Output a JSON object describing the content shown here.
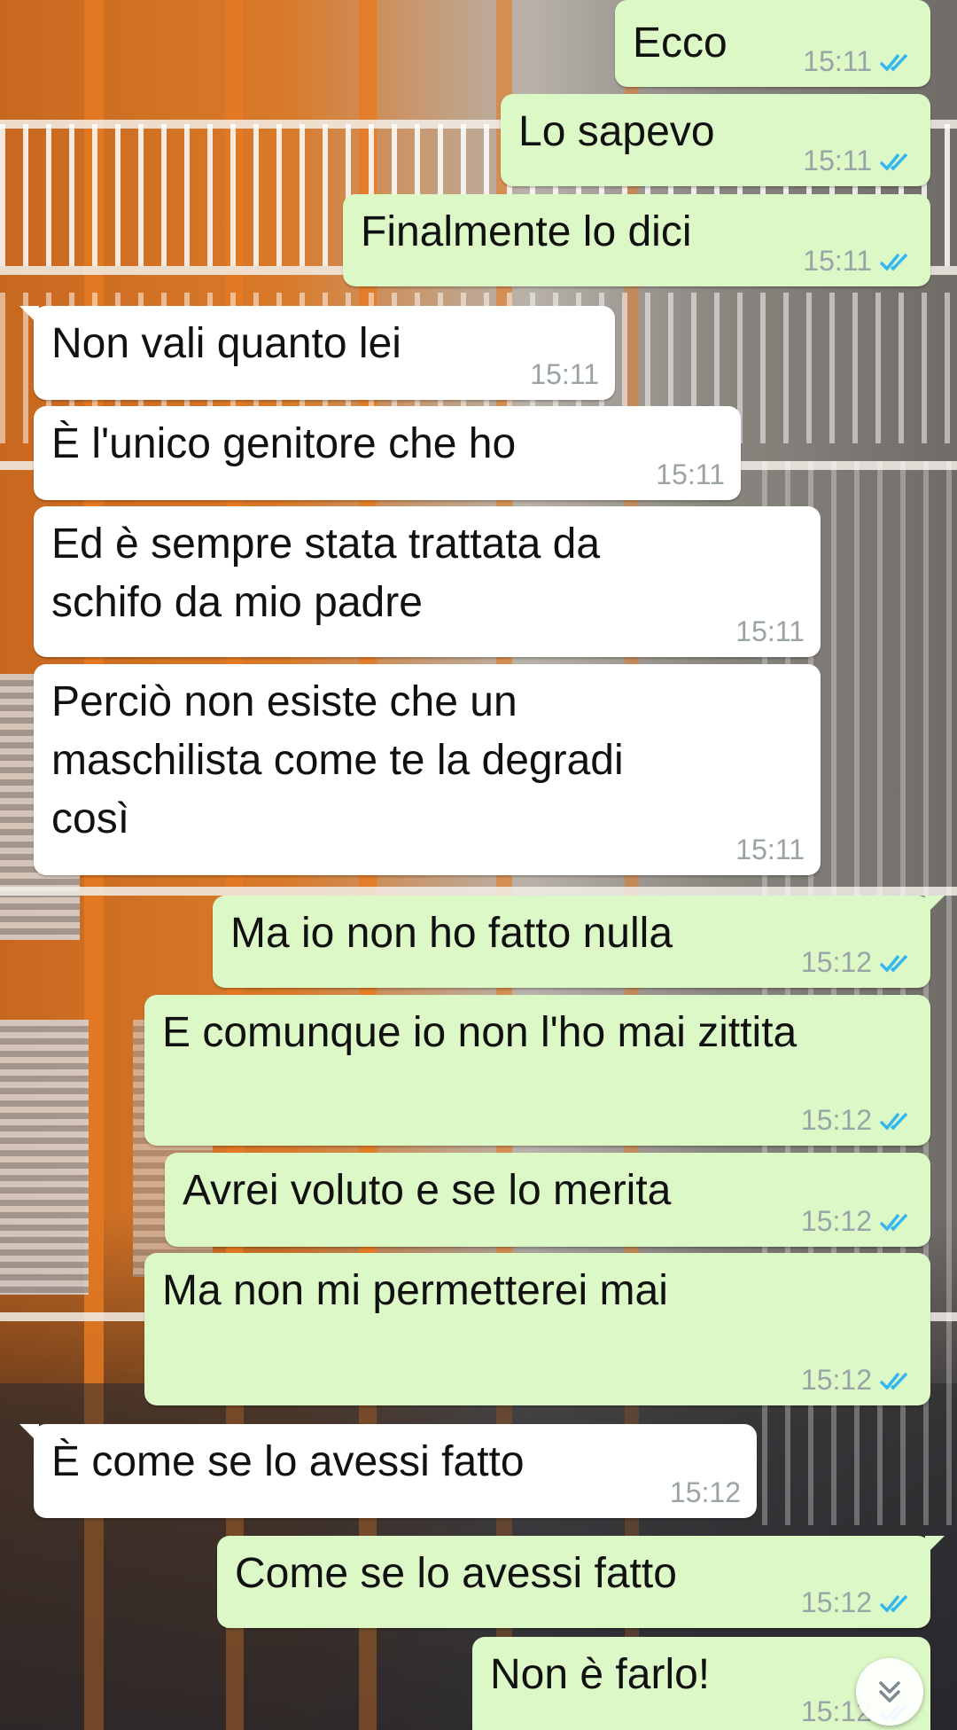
{
  "colors": {
    "outgoing_bubble": "#dcf8c6",
    "incoming_bubble": "#ffffff",
    "read_ticks": "#34b7f1",
    "timestamp": "#9aa3a6"
  },
  "messages": [
    {
      "dir": "out",
      "text": "Ecco",
      "time": "15:11",
      "status": "read"
    },
    {
      "dir": "out",
      "text": "Lo sapevo",
      "time": "15:11",
      "status": "read"
    },
    {
      "dir": "out",
      "text": "Finalmente lo dici",
      "time": "15:11",
      "status": "read"
    },
    {
      "dir": "in",
      "text": "Non vali quanto lei",
      "time": "15:11"
    },
    {
      "dir": "in",
      "text": "È l'unico genitore che ho",
      "time": "15:11"
    },
    {
      "dir": "in",
      "text": "Ed è sempre stata trattata da\nschifo da mio padre",
      "time": "15:11"
    },
    {
      "dir": "in",
      "text": "Perciò non esiste che un\nmaschilista come te la degradi\ncosì",
      "time": "15:11"
    },
    {
      "dir": "out",
      "text": "Ma io non ho fatto nulla",
      "time": "15:12",
      "status": "read"
    },
    {
      "dir": "out",
      "text": "E comunque io non l'ho mai zittita",
      "time": "15:12",
      "status": "read"
    },
    {
      "dir": "out",
      "text": "Avrei voluto e se lo merita",
      "time": "15:12",
      "status": "read"
    },
    {
      "dir": "out",
      "text": "Ma non mi permetterei mai",
      "time": "15:12",
      "status": "read"
    },
    {
      "dir": "in",
      "text": "È come se lo avessi fatto",
      "time": "15:12"
    },
    {
      "dir": "out",
      "text": "Come se lo avessi fatto",
      "time": "15:12",
      "status": "read"
    },
    {
      "dir": "out",
      "text": "Non è farlo!",
      "time": "15:12",
      "status": "read"
    }
  ],
  "scroll_button": {
    "icon": "double-chevron-down-icon"
  }
}
